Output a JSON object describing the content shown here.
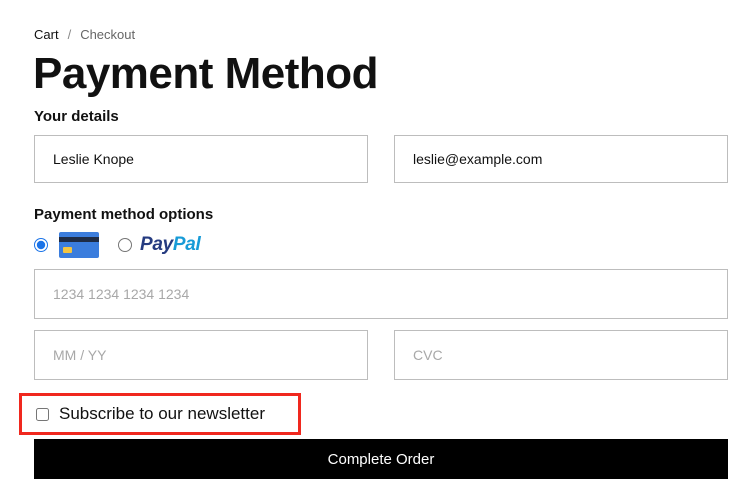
{
  "breadcrumb": {
    "items": [
      {
        "label": "Cart"
      },
      {
        "label": "Checkout"
      }
    ],
    "separator": "/"
  },
  "page_title": "Payment Method",
  "details": {
    "heading": "Your details",
    "name_value": "Leslie Knope",
    "email_value": "leslie@example.com"
  },
  "payment": {
    "heading": "Payment method options",
    "options": [
      {
        "id": "card",
        "icon": "credit-card-icon",
        "selected": true
      },
      {
        "id": "paypal",
        "icon": "paypal-logo",
        "logo_text_part1": "Pay",
        "logo_text_part2": "Pal",
        "selected": false
      }
    ],
    "card_number_placeholder": "1234 1234 1234 1234",
    "expiry_placeholder": "MM / YY",
    "cvc_placeholder": "CVC"
  },
  "newsletter": {
    "label": "Subscribe to our newsletter",
    "checked": false,
    "highlight_color": "#f0281e"
  },
  "submit": {
    "label": "Complete Order"
  },
  "colors": {
    "accent": "#1a73e8",
    "button_bg": "#000000",
    "paypal_dark": "#253b80",
    "paypal_light": "#179bd7"
  }
}
